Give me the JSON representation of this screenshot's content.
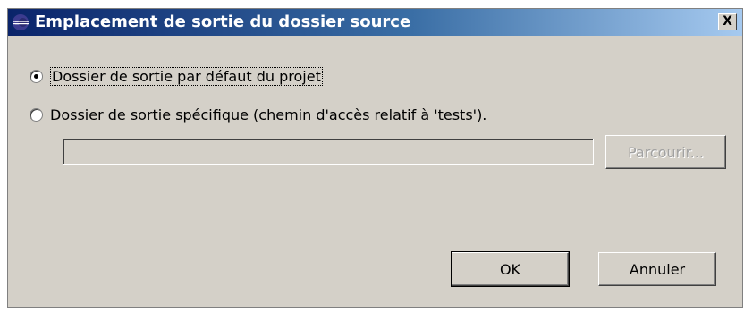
{
  "dialog": {
    "title": "Emplacement de sortie du dossier source",
    "close_label": "X"
  },
  "options": {
    "default_output": "Dossier de sortie par défaut du projet",
    "specific_output": "Dossier de sortie spécifique (chemin d'accès relatif à 'tests')."
  },
  "path": {
    "value": ""
  },
  "buttons": {
    "browse": "Parcourir...",
    "ok": "OK",
    "cancel": "Annuler"
  }
}
